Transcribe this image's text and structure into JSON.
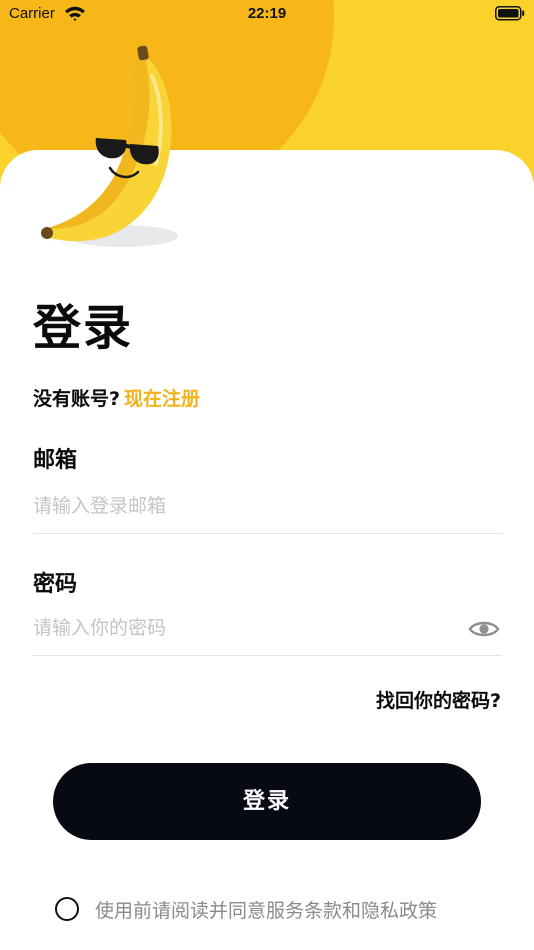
{
  "status_bar": {
    "carrier": "Carrier",
    "time": "22:19",
    "wifi_icon": "wifi-icon",
    "battery_icon": "battery-icon"
  },
  "header": {
    "mascot_icon": "banana-sunglasses-icon",
    "colors": {
      "background": "#fbd22c",
      "circle": "#f7b719"
    }
  },
  "login": {
    "title": "登录",
    "register_prompt": "没有账号?",
    "register_link": "现在注册",
    "email_label": "邮箱",
    "email_placeholder": "请输入登录邮箱",
    "email_value": "",
    "password_label": "密码",
    "password_placeholder": "请输入你的密码",
    "password_value": "",
    "password_toggle_icon": "eye-icon",
    "forgot_password": "找回你的密码?",
    "submit_label": "登录",
    "agreement_checked": false,
    "agreement_text": "使用前请阅读并同意服务条款和隐私政策"
  },
  "colors": {
    "accent": "#f2b21a",
    "button": "#070a12",
    "placeholder": "#c4c4c8",
    "muted_text": "#8a8a8e"
  }
}
